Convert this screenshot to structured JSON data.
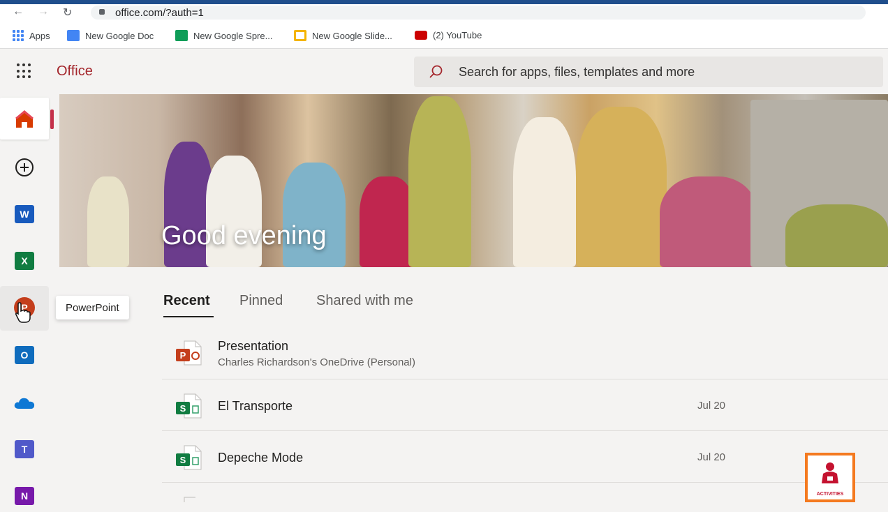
{
  "browser": {
    "url": "office.com/?auth=1",
    "bookmarks": [
      {
        "label": "Apps",
        "icon": "apps-grid-icon"
      },
      {
        "label": "New Google Doc",
        "icon": "google-docs-icon",
        "color": "#4285f4"
      },
      {
        "label": "New Google Spre...",
        "icon": "google-sheets-icon",
        "color": "#0f9d58"
      },
      {
        "label": "New Google Slide...",
        "icon": "google-slides-icon",
        "color": "#f4b400"
      },
      {
        "label": "(2) YouTube",
        "icon": "youtube-icon",
        "color": "#ff0000"
      }
    ]
  },
  "header": {
    "brand": "Office",
    "search_placeholder": "Search for apps, files, templates and more"
  },
  "rail": {
    "items": [
      {
        "name": "home",
        "icon": "home-icon"
      },
      {
        "name": "create",
        "icon": "add-circle-icon"
      },
      {
        "name": "word",
        "icon": "word-icon",
        "letter": "W",
        "color": "#185abd"
      },
      {
        "name": "excel",
        "icon": "excel-icon",
        "letter": "X",
        "color": "#107c41"
      },
      {
        "name": "powerpoint",
        "icon": "powerpoint-icon",
        "letter": "P",
        "color": "#c43e1c"
      },
      {
        "name": "outlook",
        "icon": "outlook-icon",
        "letter": "O",
        "color": "#0f6cbd"
      },
      {
        "name": "onedrive",
        "icon": "onedrive-icon",
        "color": "#0f78d4"
      },
      {
        "name": "teams",
        "icon": "teams-icon",
        "letter": "T",
        "color": "#5059c9"
      },
      {
        "name": "onenote",
        "icon": "onenote-icon",
        "letter": "N",
        "color": "#7719aa"
      }
    ],
    "tooltip": "PowerPoint"
  },
  "hero": {
    "greeting": "Good evening"
  },
  "tabs": [
    {
      "label": "Recent",
      "active": true
    },
    {
      "label": "Pinned",
      "active": false
    },
    {
      "label": "Shared with me",
      "active": false
    }
  ],
  "files": [
    {
      "name": "Presentation",
      "location": "Charles Richardson's OneDrive (Personal)",
      "date": "",
      "type": "powerpoint"
    },
    {
      "name": "El Transporte",
      "location": "",
      "date": "Jul 20",
      "type": "sheets"
    },
    {
      "name": "Depeche Mode",
      "location": "",
      "date": "Jul 20",
      "type": "sheets"
    }
  ],
  "badge": {
    "text": "ACTIVITIES"
  }
}
